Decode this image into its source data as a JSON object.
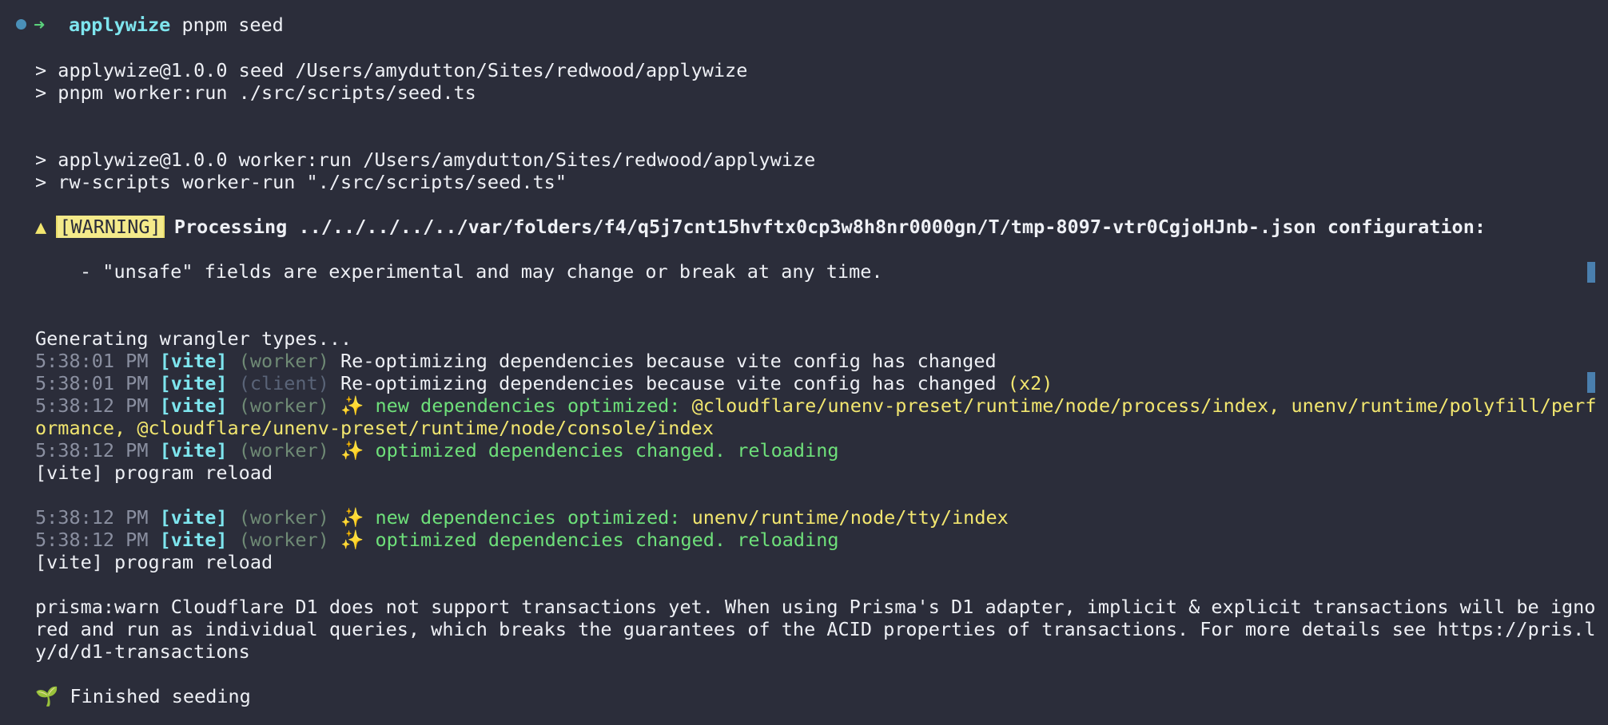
{
  "prompt": {
    "cwd": "applywize",
    "command": "pnpm seed"
  },
  "lines": {
    "l1": "> applywize@1.0.0 seed /Users/amydutton/Sites/redwood/applywize",
    "l2": "> pnpm worker:run ./src/scripts/seed.ts",
    "l3": "> applywize@1.0.0 worker:run /Users/amydutton/Sites/redwood/applywize",
    "l4": "> rw-scripts worker-run \"./src/scripts/seed.ts\"",
    "warn_symbol": "▲",
    "warn_badge": "[WARNING]",
    "warn_text": "Processing ../../../../../var/folders/f4/q5j7cnt15hvftx0cp3w8h8nr0000gn/T/tmp-8097-vtr0CgjoHJnb-.json configuration:",
    "warn_detail": "- \"unsafe\" fields are experimental and may change or break at any time.",
    "gen": "Generating wrangler types...",
    "log1": {
      "time": "5:38:01 PM",
      "tag": "[vite]",
      "ctx": "(worker)",
      "msg": "Re-optimizing dependencies because vite config has changed"
    },
    "log2": {
      "time": "5:38:01 PM",
      "tag": "[vite]",
      "ctx": "(client)",
      "msg": "Re-optimizing dependencies because vite config has changed",
      "suffix": "(x2)"
    },
    "log3": {
      "time": "5:38:12 PM",
      "tag": "[vite]",
      "ctx": "(worker)",
      "spark": "✨",
      "msg": "new dependencies optimized:",
      "deps": "@cloudflare/unenv-preset/runtime/node/process/index, unenv/runtime/polyfill/perf",
      "deps_cont": "ormance, @cloudflare/unenv-preset/runtime/node/console/index"
    },
    "log4": {
      "time": "5:38:12 PM",
      "tag": "[vite]",
      "ctx": "(worker)",
      "spark": "✨",
      "msg": "optimized dependencies changed. reloading"
    },
    "reload1": "[vite] program reload",
    "log5": {
      "time": "5:38:12 PM",
      "tag": "[vite]",
      "ctx": "(worker)",
      "spark": "✨",
      "msg": "new dependencies optimized:",
      "deps": "unenv/runtime/node/tty/index"
    },
    "log6": {
      "time": "5:38:12 PM",
      "tag": "[vite]",
      "ctx": "(worker)",
      "spark": "✨",
      "msg": "optimized dependencies changed. reloading"
    },
    "reload2": "[vite] program reload",
    "prisma1": "prisma:warn Cloudflare D1 does not support transactions yet. When using Prisma's D1 adapter, implicit & explicit transactions will be igno",
    "prisma2": "red and run as individual queries, which breaks the guarantees of the ACID properties of transactions. For more details see https://pris.l",
    "prisma3": "y/d/d1-transactions",
    "sprout": "🌱",
    "finished": "Finished seeding"
  },
  "colors": {
    "background": "#2b2d3a",
    "cyan": "#7ee5ee",
    "green": "#6ee07a",
    "yellow": "#f2e66f"
  }
}
